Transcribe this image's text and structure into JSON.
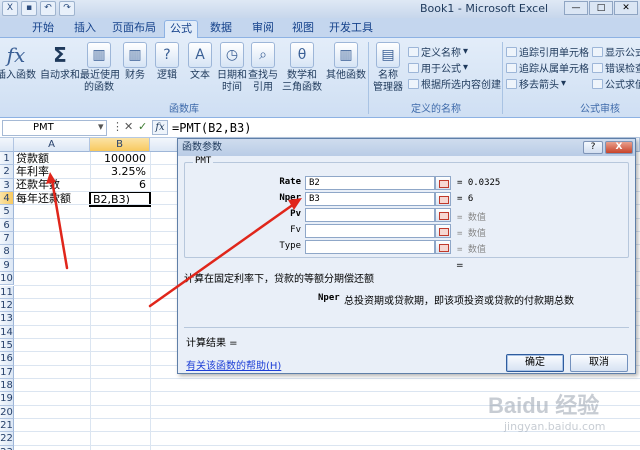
{
  "window": {
    "title": "Book1 - Microsoft Excel",
    "controls": [
      "—",
      "□",
      "✕"
    ]
  },
  "ribbon_tabs": [
    "开始",
    "插入",
    "页面布局",
    "公式",
    "数据",
    "审阅",
    "视图",
    "开发工具"
  ],
  "ribbon": {
    "insert_function": "插入函数",
    "autosum": "自动求和",
    "recent": [
      "最近使用",
      "的函数"
    ],
    "financial": "财务",
    "logical": "逻辑",
    "text": "文本",
    "datetime": [
      "日期和",
      "时间"
    ],
    "lookup": [
      "查找与",
      "引用"
    ],
    "math": [
      "数学和",
      "三角函数"
    ],
    "other": "其他函数",
    "name_manager": [
      "名称",
      "管理器"
    ],
    "define_name": "定义名称",
    "use_in_formula": "用于公式",
    "create_from_selection": "根据所选内容创建",
    "trace_precedents": "追踪引用单元格",
    "trace_dependents": "追踪从属单元格",
    "remove_arrows": "移去箭头",
    "show_formulas": "显示公式",
    "error_checking": "错误检查",
    "evaluate": "公式求值",
    "group_function_library": "函数库",
    "group_defined_names": "定义的名称",
    "group_auditing": "公式审核"
  },
  "formula_bar": {
    "name_box": "PMT",
    "formula": "=PMT(B2,B3)"
  },
  "grid": {
    "columns": [
      "A",
      "B"
    ],
    "rows": [
      "1",
      "2",
      "3",
      "4",
      "5",
      "6",
      "7",
      "8",
      "9",
      "10",
      "11",
      "12",
      "13",
      "14",
      "15",
      "16",
      "17",
      "18",
      "19",
      "20",
      "21",
      "22",
      "23"
    ],
    "cells": {
      "A1": "贷款额",
      "A2": "年利率",
      "A3": "还款年数",
      "A4": "每年还款额",
      "B1": "100000",
      "B2": "3.25%",
      "B3": "6",
      "B4": "B2,B3)"
    }
  },
  "dialog": {
    "title": "函数参数",
    "function_name": "PMT",
    "arguments": [
      {
        "label": "Rate",
        "value": "B2",
        "result": "= 0.0325"
      },
      {
        "label": "Nper",
        "value": "B3",
        "result": "= 6"
      },
      {
        "label": "Pv",
        "value": "",
        "result": "= 数值"
      },
      {
        "label": "Fv",
        "value": "",
        "result": "= 数值"
      },
      {
        "label": "Type",
        "value": "",
        "result": "= 数值"
      }
    ],
    "equals_blank": "=",
    "description": "计算在固定利率下，贷款的等额分期偿还额",
    "arg_desc_name": "Nper",
    "arg_desc_text": "总投资期或贷款期，即该项投资或贷款的付款期总数",
    "result_label": "计算结果 =",
    "help_link": "有关该函数的帮助(H)",
    "ok": "确定",
    "cancel": "取消",
    "help_btn": "?",
    "close_btn": "X"
  },
  "watermark": {
    "text": "Baidu 经验",
    "sub": "jingyan.baidu.com"
  },
  "colors": {
    "arrow": "#e0261b",
    "link": "#1d3ed6",
    "ribbon": "#dbe7f6"
  }
}
